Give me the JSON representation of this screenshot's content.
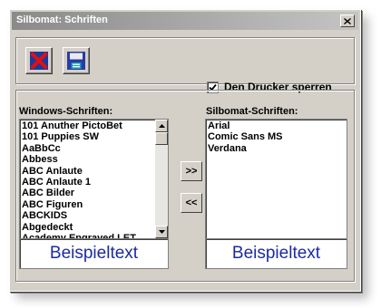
{
  "window": {
    "title": "Silbomat: Schriften"
  },
  "toolbar": {
    "cancel_icon": "red-x-icon",
    "save_icon": "floppy-disk-icon",
    "lock_printer_label": "Den Drucker sperren",
    "lock_printer_checked": true
  },
  "windows_fonts": {
    "label": "Windows-Schriften:",
    "items": [
      "101 Anuther PictoBet",
      "101 Puppies SW",
      "AaBbCc",
      "Abbess",
      "ABC Anlaute",
      "ABC Anlaute 1",
      "ABC Bilder",
      "ABC Figuren",
      "ABCKIDS",
      "Abgedeckt",
      "Academy Engraved LET"
    ],
    "sample": "Beispieltext"
  },
  "silbomat_fonts": {
    "label": "Silbomat-Schriften:",
    "items": [
      "Arial",
      "Comic Sans MS",
      "Verdana"
    ],
    "sample": "Beispieltext"
  },
  "move": {
    "add_label": ">>",
    "remove_label": "<<"
  },
  "colors": {
    "sample_text": "#1c2aa0",
    "dialog_bg": "#d4d0c8"
  }
}
